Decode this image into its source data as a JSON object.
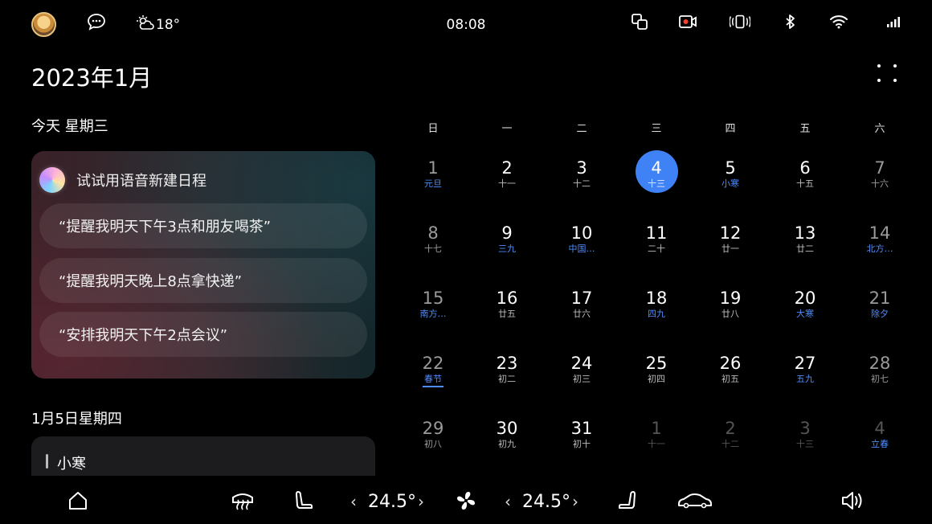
{
  "status_bar": {
    "time": "08:08",
    "weather": {
      "icon": "partly-cloudy-icon",
      "temperature": "18°"
    },
    "icons": [
      "avatar",
      "message-icon",
      "screen-mirror-icon",
      "record-icon",
      "vibrate-icon",
      "bluetooth-icon",
      "wifi-icon",
      "signal-icon"
    ]
  },
  "header": {
    "month_title": "2023年1月"
  },
  "today": {
    "label": "今天 星期三",
    "voice_card": {
      "title": "试试用语音新建日程",
      "suggestions": [
        "“提醒我明天下午3点和朋友喝茶”",
        "“提醒我明天晚上8点拿快递”",
        "“安排我明天下午2点会议”"
      ]
    }
  },
  "next_day": {
    "label": "1月5日星期四",
    "event_title": "小寒"
  },
  "calendar": {
    "weekdays": [
      "日",
      "一",
      "二",
      "三",
      "四",
      "五",
      "六"
    ],
    "weeks": [
      [
        {
          "d": "1",
          "l": "元旦",
          "hl": true
        },
        {
          "d": "2",
          "l": "十一"
        },
        {
          "d": "3",
          "l": "十二"
        },
        {
          "d": "4",
          "l": "十三",
          "today": true
        },
        {
          "d": "5",
          "l": "小寒",
          "hl": true
        },
        {
          "d": "6",
          "l": "十五"
        },
        {
          "d": "7",
          "l": "十六"
        }
      ],
      [
        {
          "d": "8",
          "l": "十七"
        },
        {
          "d": "9",
          "l": "三九",
          "hl": true
        },
        {
          "d": "10",
          "l": "中国…",
          "hl": true
        },
        {
          "d": "11",
          "l": "二十"
        },
        {
          "d": "12",
          "l": "廿一"
        },
        {
          "d": "13",
          "l": "廿二"
        },
        {
          "d": "14",
          "l": "北方…",
          "hl": true
        }
      ],
      [
        {
          "d": "15",
          "l": "南方…",
          "hl": true
        },
        {
          "d": "16",
          "l": "廿五"
        },
        {
          "d": "17",
          "l": "廿六"
        },
        {
          "d": "18",
          "l": "四九",
          "hl": true
        },
        {
          "d": "19",
          "l": "廿八"
        },
        {
          "d": "20",
          "l": "大寒",
          "hl": true
        },
        {
          "d": "21",
          "l": "除夕",
          "hl": true
        }
      ],
      [
        {
          "d": "22",
          "l": "春节",
          "hl": true,
          "underline": true
        },
        {
          "d": "23",
          "l": "初二"
        },
        {
          "d": "24",
          "l": "初三"
        },
        {
          "d": "25",
          "l": "初四"
        },
        {
          "d": "26",
          "l": "初五"
        },
        {
          "d": "27",
          "l": "五九",
          "hl": true
        },
        {
          "d": "28",
          "l": "初七"
        }
      ],
      [
        {
          "d": "29",
          "l": "初八"
        },
        {
          "d": "30",
          "l": "初九"
        },
        {
          "d": "31",
          "l": "初十"
        },
        {
          "d": "1",
          "l": "十一",
          "other": true
        },
        {
          "d": "2",
          "l": "十二",
          "other": true
        },
        {
          "d": "3",
          "l": "十三",
          "other": true
        },
        {
          "d": "4",
          "l": "立春",
          "other": true,
          "hl": true
        }
      ]
    ]
  },
  "dock": {
    "left_temp": "24.5°",
    "right_temp": "24.5°",
    "icons": [
      "home-icon",
      "rear-defrost-icon",
      "driver-seat-icon",
      "fan-icon",
      "passenger-seat-icon",
      "car-icon",
      "volume-icon"
    ]
  },
  "colors": {
    "accent": "#3f82f5",
    "holiday_text": "#4e8dff",
    "background": "#000000"
  }
}
